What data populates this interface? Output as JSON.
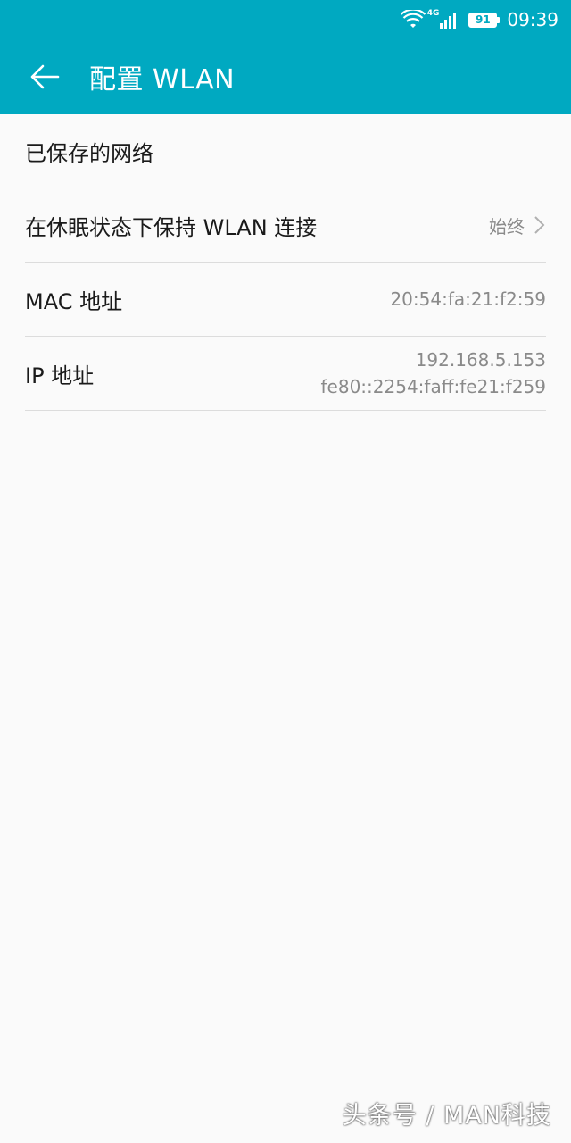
{
  "status_bar": {
    "network": "4G",
    "battery": "91",
    "time": "09:39",
    "icons": [
      "wifi-icon",
      "signal-icon",
      "battery-icon"
    ]
  },
  "toolbar": {
    "back_icon": "arrow-left-icon",
    "title": "配置 WLAN"
  },
  "settings": {
    "saved_networks": {
      "label": "已保存的网络"
    },
    "keep_wlan_sleep": {
      "label": "在休眠状态下保持 WLAN 连接",
      "value": "始终"
    },
    "mac": {
      "label": "MAC 地址",
      "value": "20:54:fa:21:f2:59"
    },
    "ip": {
      "label": "IP 地址",
      "ipv4": "192.168.5.153",
      "ipv6": "fe80::2254:faff:fe21:f259"
    }
  },
  "watermark": "头条号 / MAN科技",
  "colors": {
    "header": "#00a9c1",
    "background": "#fafafa",
    "secondary_text": "#8a8a8a"
  }
}
